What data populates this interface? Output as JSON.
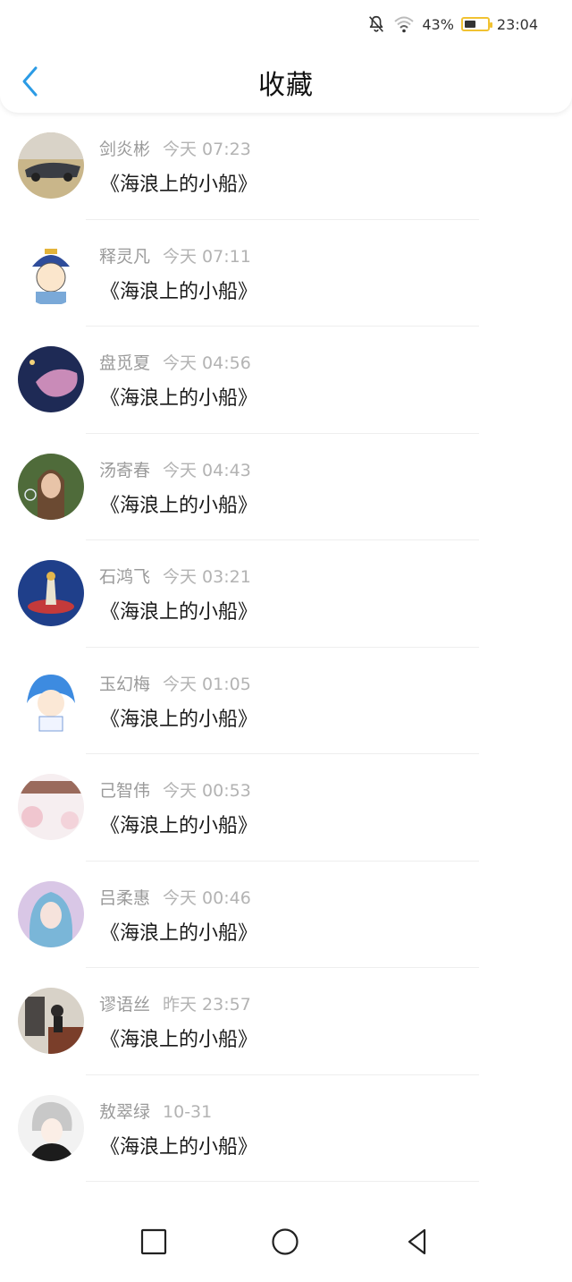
{
  "status_bar": {
    "battery_percent": "43%",
    "battery_level": 0.43,
    "time": "23:04",
    "icons": [
      "bell-muted-icon",
      "wifi-icon",
      "battery-icon"
    ]
  },
  "header": {
    "title": "收藏",
    "back_icon": "chevron-left-icon"
  },
  "colors": {
    "accent": "#2b9be5",
    "battery": "#f1c232"
  },
  "list": {
    "items": [
      {
        "name": "剑炎彬",
        "time": "今天 07:23",
        "message": "《海浪上的小船》"
      },
      {
        "name": "释灵凡",
        "time": "今天 07:11",
        "message": "《海浪上的小船》"
      },
      {
        "name": "盘觅夏",
        "time": "今天 04:56",
        "message": "《海浪上的小船》"
      },
      {
        "name": "汤寄春",
        "time": "今天 04:43",
        "message": "《海浪上的小船》"
      },
      {
        "name": "石鸿飞",
        "time": "今天 03:21",
        "message": "《海浪上的小船》"
      },
      {
        "name": "玉幻梅",
        "time": "今天 01:05",
        "message": "《海浪上的小船》"
      },
      {
        "name": "己智伟",
        "time": "今天 00:53",
        "message": "《海浪上的小船》"
      },
      {
        "name": "吕柔惠",
        "time": "今天 00:46",
        "message": "《海浪上的小船》"
      },
      {
        "name": "谬语丝",
        "time": "昨天 23:57",
        "message": "《海浪上的小船》"
      },
      {
        "name": "敖翠绿",
        "time": "10-31",
        "message": "《海浪上的小船》"
      }
    ]
  },
  "nav_bar": {
    "buttons": [
      "square-recents-icon",
      "circle-home-icon",
      "triangle-back-icon"
    ]
  }
}
